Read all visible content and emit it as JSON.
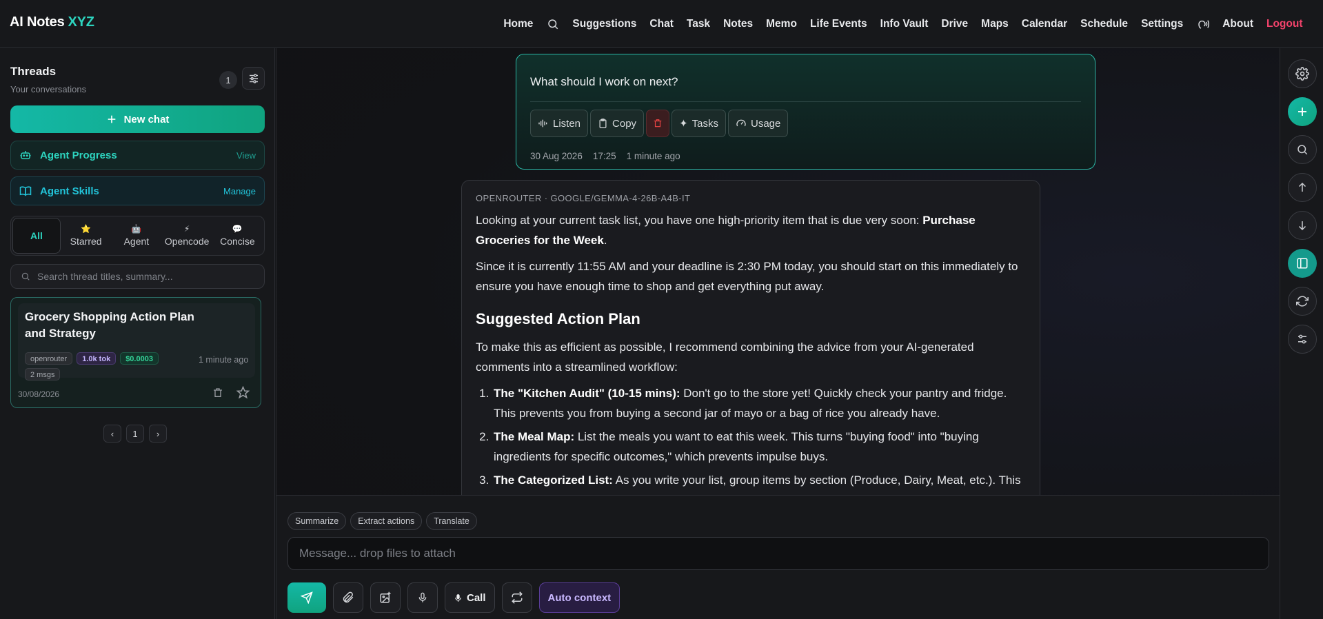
{
  "brand": {
    "part1": "AI Notes",
    "part2": "XYZ"
  },
  "nav": {
    "home": "Home",
    "suggestions": "Suggestions",
    "chat": "Chat",
    "task": "Task",
    "notes": "Notes",
    "memo": "Memo",
    "life_events": "Life Events",
    "info_vault": "Info Vault",
    "drive": "Drive",
    "maps": "Maps",
    "calendar": "Calendar",
    "schedule": "Schedule",
    "settings": "Settings",
    "about": "About",
    "logout": "Logout"
  },
  "sidebar": {
    "title": "Threads",
    "subtitle": "Your conversations",
    "count": "1",
    "new_chat": "New chat",
    "agent_progress": {
      "label": "Agent Progress",
      "action": "View"
    },
    "agent_skills": {
      "label": "Agent Skills",
      "action": "Manage"
    },
    "tabs": [
      {
        "label": "All",
        "icon": ""
      },
      {
        "label": "Starred",
        "icon": "⭐"
      },
      {
        "label": "Agent",
        "icon": "🤖"
      },
      {
        "label": "Opencode",
        "icon": "⚡"
      },
      {
        "label": "Concise",
        "icon": "💬"
      }
    ],
    "search_placeholder": "Search thread titles, summary...",
    "thread": {
      "title": "Grocery Shopping Action Plan and Strategy",
      "tags": {
        "provider": "openrouter",
        "tokens": "1.0k tok",
        "cost": "$0.0003",
        "msgs": "2 msgs"
      },
      "time": "1 minute ago",
      "date": "30/08/2026"
    },
    "pager": {
      "prev": "‹",
      "page": "1",
      "next": "›"
    }
  },
  "user_message": {
    "text": "What should I work on next?",
    "actions": {
      "listen": "Listen",
      "copy": "Copy",
      "tasks": "Tasks",
      "usage": "Usage"
    },
    "date": "30 Aug 2026",
    "time": "17:25",
    "ago": "1 minute ago"
  },
  "ai_message": {
    "header": "OPENROUTER · GOOGLE/GEMMA-4-26B-A4B-IT",
    "p1_a": "Looking at your current task list, you have one high-priority item that is due very soon: ",
    "p1_b": "Purchase Groceries for the Week",
    "p1_c": ".",
    "p2": "Since it is currently 11:55 AM and your deadline is 2:30 PM today, you should start on this immediately to ensure you have enough time to shop and get everything put away.",
    "heading": "Suggested Action Plan",
    "p3": "To make this as efficient as possible, I recommend combining the advice from your AI-generated comments into a streamlined workflow:",
    "steps": [
      {
        "title": "The \"Kitchen Audit\" (10-15 mins):",
        "text": " Don't go to the store yet! Quickly check your pantry and fridge. This prevents you from buying a second jar of mayo or a bag of rice you already have."
      },
      {
        "title": "The Meal Map:",
        "text": " List the meals you want to eat this week. This turns \"buying food\" into \"buying ingredients for specific outcomes,\" which prevents impulse buys."
      },
      {
        "title": "The Categorized List:",
        "text": " As you write your list, group items by section (Produce, Dairy, Meat, etc.). This"
      }
    ]
  },
  "composer": {
    "chips": [
      "Summarize",
      "Extract actions",
      "Translate"
    ],
    "placeholder": "Message... drop files to attach",
    "call": "Call",
    "auto_context": "Auto context"
  },
  "colors": {
    "accent": "#2dd4bf",
    "logout": "#f4436c",
    "brand_accent": "#2dd4bf"
  }
}
